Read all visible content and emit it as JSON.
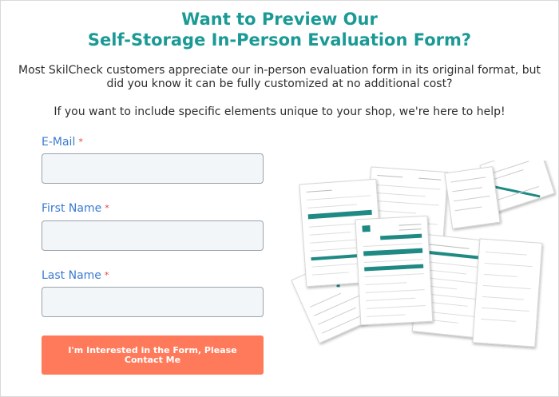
{
  "heading": {
    "line1": "Want to Preview Our",
    "line2": "Self-Storage In-Person Evaluation Form?"
  },
  "intro": {
    "paragraph": "Most SkilCheck customers appreciate our in-person evaluation form in its original format, but did you know it can be fully customized at no additional cost?",
    "note": "If you want to include specific elements unique to your shop, we're here to help!"
  },
  "form": {
    "required_marker": "*",
    "fields": [
      {
        "label": "E-Mail",
        "value": "",
        "placeholder": ""
      },
      {
        "label": "First Name",
        "value": "",
        "placeholder": ""
      },
      {
        "label": "Last Name",
        "value": "",
        "placeholder": ""
      }
    ],
    "submit_label": "I'm Interested in the Form, Please Contact Me"
  },
  "colors": {
    "heading": "#1b9a95",
    "label": "#3a7bd0",
    "required": "#e0443e",
    "button": "#ff7a5a",
    "form_accent": "#1f8a84"
  },
  "illustration": {
    "icon": "form-preview-collage"
  }
}
